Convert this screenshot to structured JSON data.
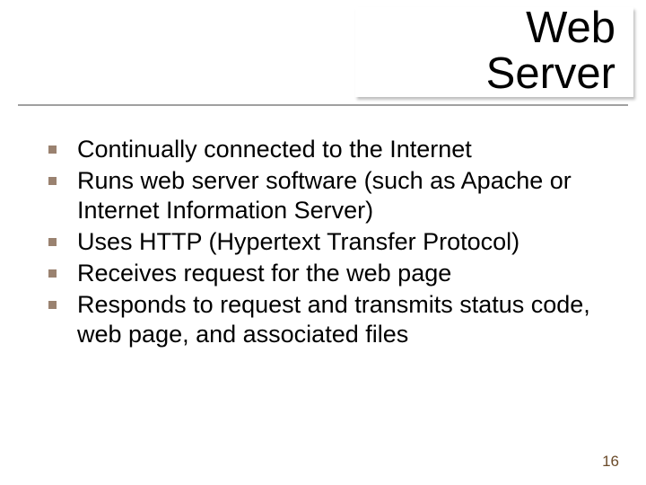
{
  "title": {
    "line1": "Web",
    "line2": "Server"
  },
  "bullets": [
    "Continually connected to the Internet",
    "Runs web server software (such as Apache or Internet Information Server)",
    "Uses HTTP (Hypertext Transfer Protocol)",
    "Receives request for the web page",
    "Responds to request and transmits status code, web page, and associated files"
  ],
  "page_number": "16"
}
